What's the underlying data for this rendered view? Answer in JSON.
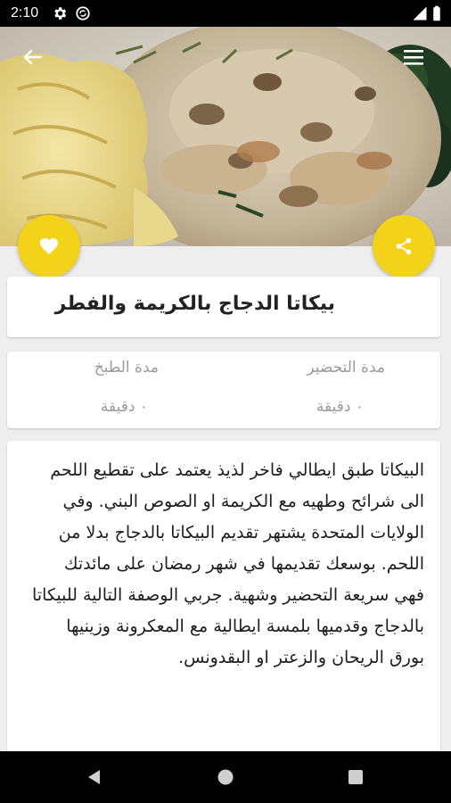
{
  "status_bar": {
    "time": "2:10",
    "icons": [
      "gear-icon",
      "sync-icon",
      "signal-icon",
      "battery-icon"
    ]
  },
  "toolbar": {
    "back_icon": "back-arrow-icon",
    "menu_icon": "hamburger-menu-icon"
  },
  "actions": {
    "favorite_icon": "heart-icon",
    "share_icon": "share-icon",
    "accent_color": "#f3d31a"
  },
  "recipe": {
    "title": "بيكاتا الدجاج بالكريمة والفطر",
    "prep_label": "مدة التحضير",
    "prep_value": "٠ دقيقة",
    "cook_label": "مدة الطبخ",
    "cook_value": "٠ دقيقة",
    "description": "البيكاتا طبق ايطالي فاخر لذيذ يعتمد على تقطيع اللحم الى شرائح وطهيه مع الكريمة او الصوص البني. وفي الولايات المتحدة يشتهر تقديم البيكاتا بالدجاج بدلا من اللحم. بوسعك تقديمها في شهر رمضان على مائدتك فهي سريعة التحضير وشهية. جربي الوصفة التالية للبيكاتا بالدجاج وقدميها بلمسة ايطالية مع المعكرونة وزينيها بورق الريحان والزعتر او البقدونس."
  },
  "system_nav": {
    "back_icon": "triangle-back-icon",
    "home_icon": "circle-home-icon",
    "recents_icon": "square-recents-icon"
  }
}
